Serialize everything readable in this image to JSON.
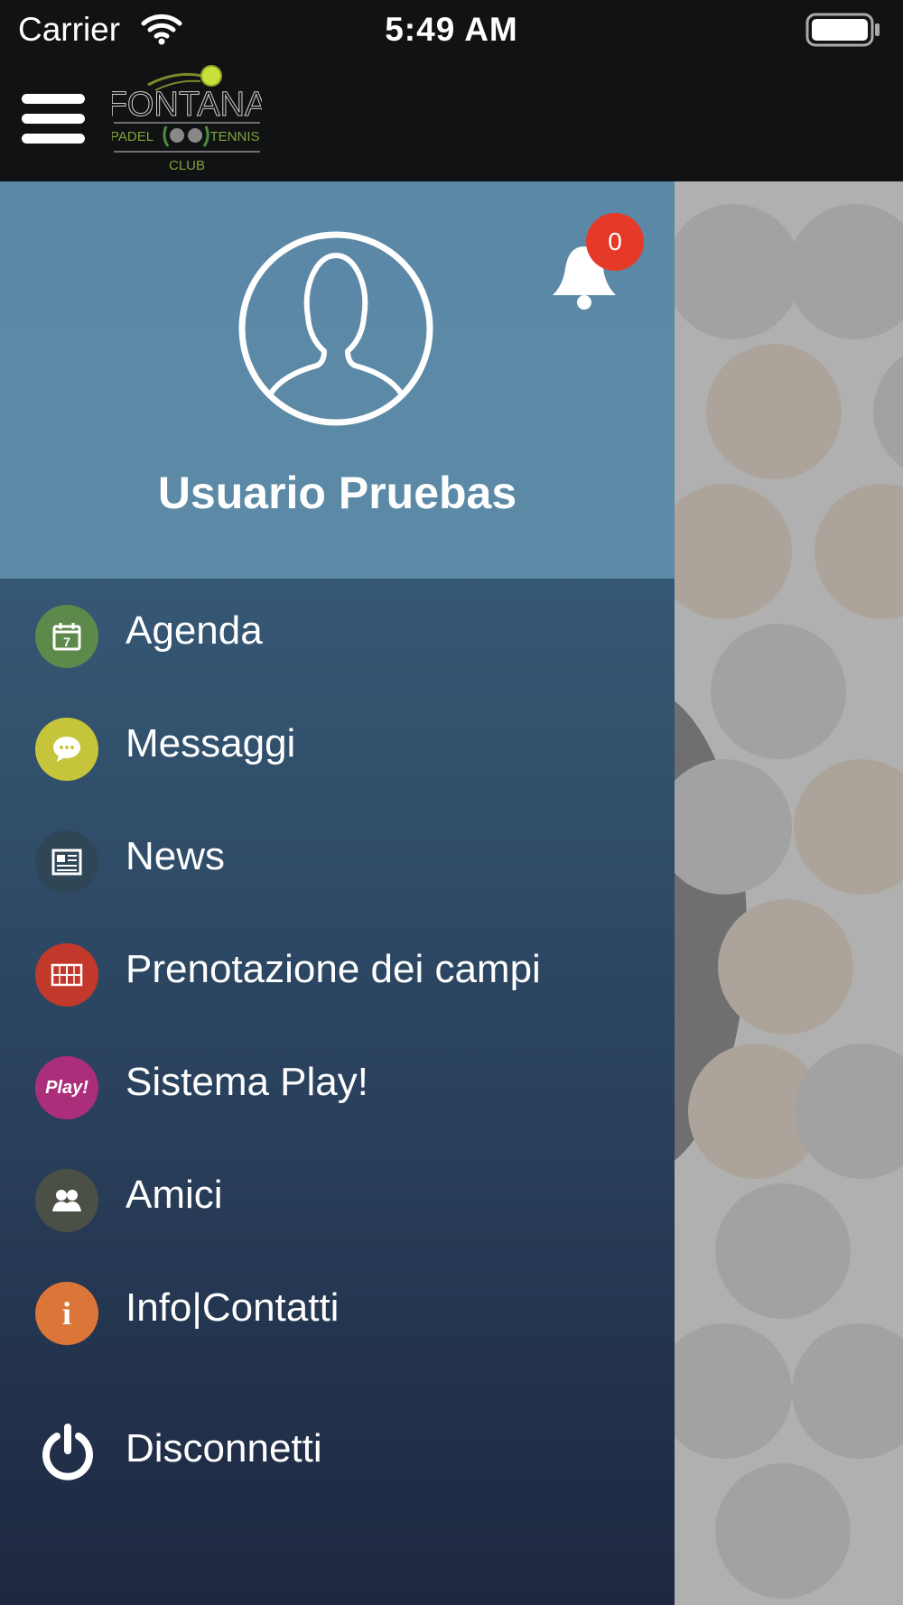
{
  "status": {
    "carrier": "Carrier",
    "time": "5:49 AM"
  },
  "header": {
    "logo_main": "FONTANA",
    "logo_left": "PADEL",
    "logo_right": "TENNIS",
    "logo_bottom": "CLUB"
  },
  "profile": {
    "name": "Usuario Pruebas",
    "notifications": "0"
  },
  "menu": [
    {
      "label": "Agenda",
      "icon": "calendar-icon",
      "color": "#5d8a4b",
      "icon_text": "7"
    },
    {
      "label": "Messaggi",
      "icon": "chat-icon",
      "color": "#c6c43b"
    },
    {
      "label": "News",
      "icon": "newspaper-icon",
      "color": "#2f4657"
    },
    {
      "label": "Prenotazione dei campi",
      "icon": "court-icon",
      "color": "#c2392b"
    },
    {
      "label": "Sistema Play!",
      "icon": "play-logo-icon",
      "color": "#ab2e7b",
      "icon_text": "Play!"
    },
    {
      "label": "Amici",
      "icon": "friends-icon",
      "color": "#4b5046"
    },
    {
      "label": "Info|Contatti",
      "icon": "info-icon",
      "color": "#db7538",
      "icon_text": "i"
    },
    {
      "label": "Disconnetti",
      "icon": "power-icon"
    }
  ]
}
